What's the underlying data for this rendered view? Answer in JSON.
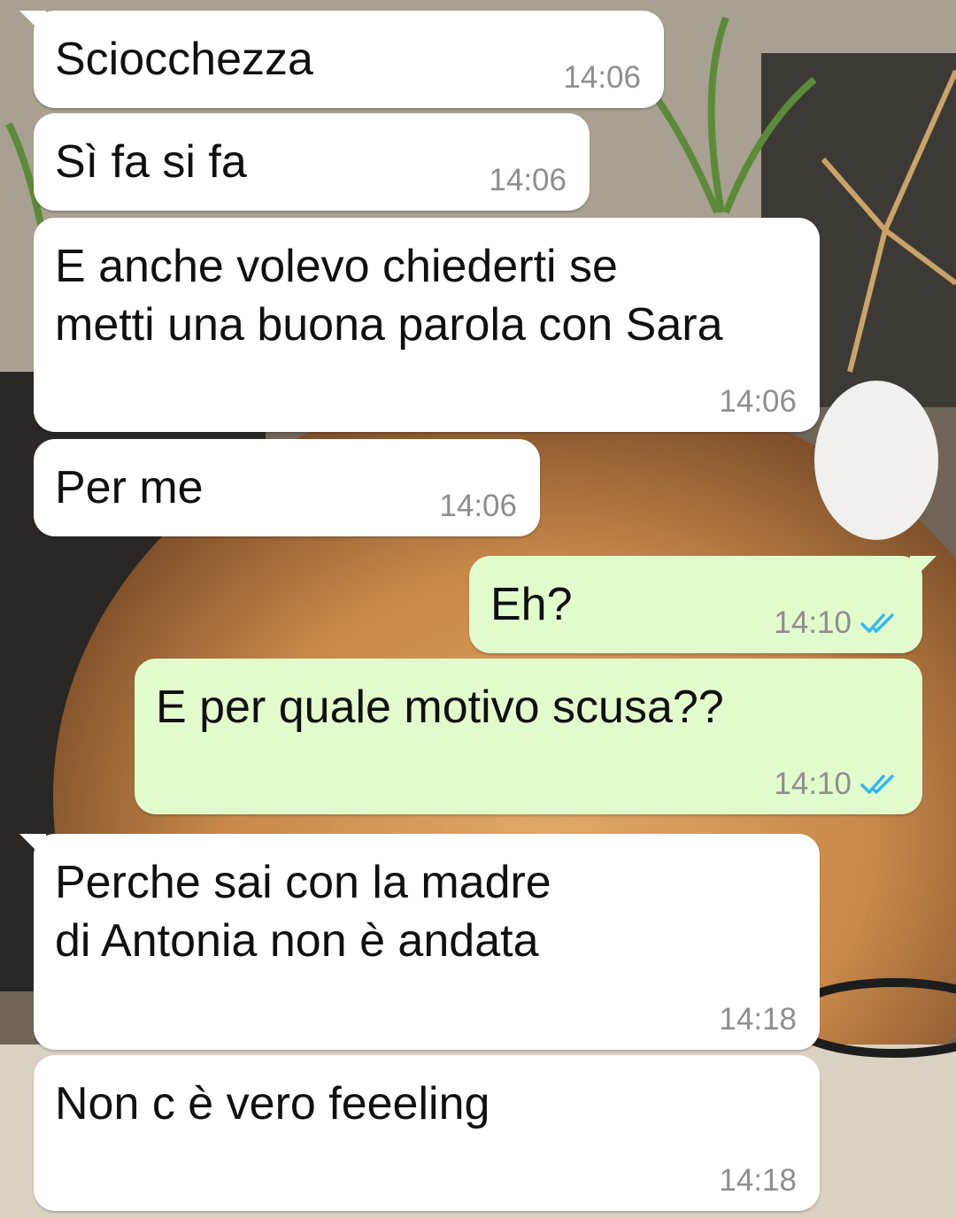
{
  "colors": {
    "incoming_bubble": "#ffffff",
    "outgoing_bubble": "#e2fbcd",
    "timestamp": "#8e8e8e",
    "read_ticks": "#34b7f1"
  },
  "messages": [
    {
      "direction": "incoming",
      "text": "Sciocchezza",
      "time": "14:06"
    },
    {
      "direction": "incoming",
      "text": "Sì fa si fa",
      "time": "14:06"
    },
    {
      "direction": "incoming",
      "text": "E anche volevo chiederti se\nmetti una buona parola con Sara",
      "time": "14:06"
    },
    {
      "direction": "incoming",
      "text": "Per me",
      "time": "14:06"
    },
    {
      "direction": "outgoing",
      "text": "Eh?",
      "time": "14:10",
      "status_icon": "double-check-icon"
    },
    {
      "direction": "outgoing",
      "text": "E per quale motivo scusa??",
      "time": "14:10",
      "status_icon": "double-check-icon"
    },
    {
      "direction": "incoming",
      "text": "Perche sai con la madre\ndi Antonia non è andata",
      "time": "14:18"
    },
    {
      "direction": "incoming",
      "text": "Non c è vero feeeling",
      "time": "14:18"
    }
  ]
}
